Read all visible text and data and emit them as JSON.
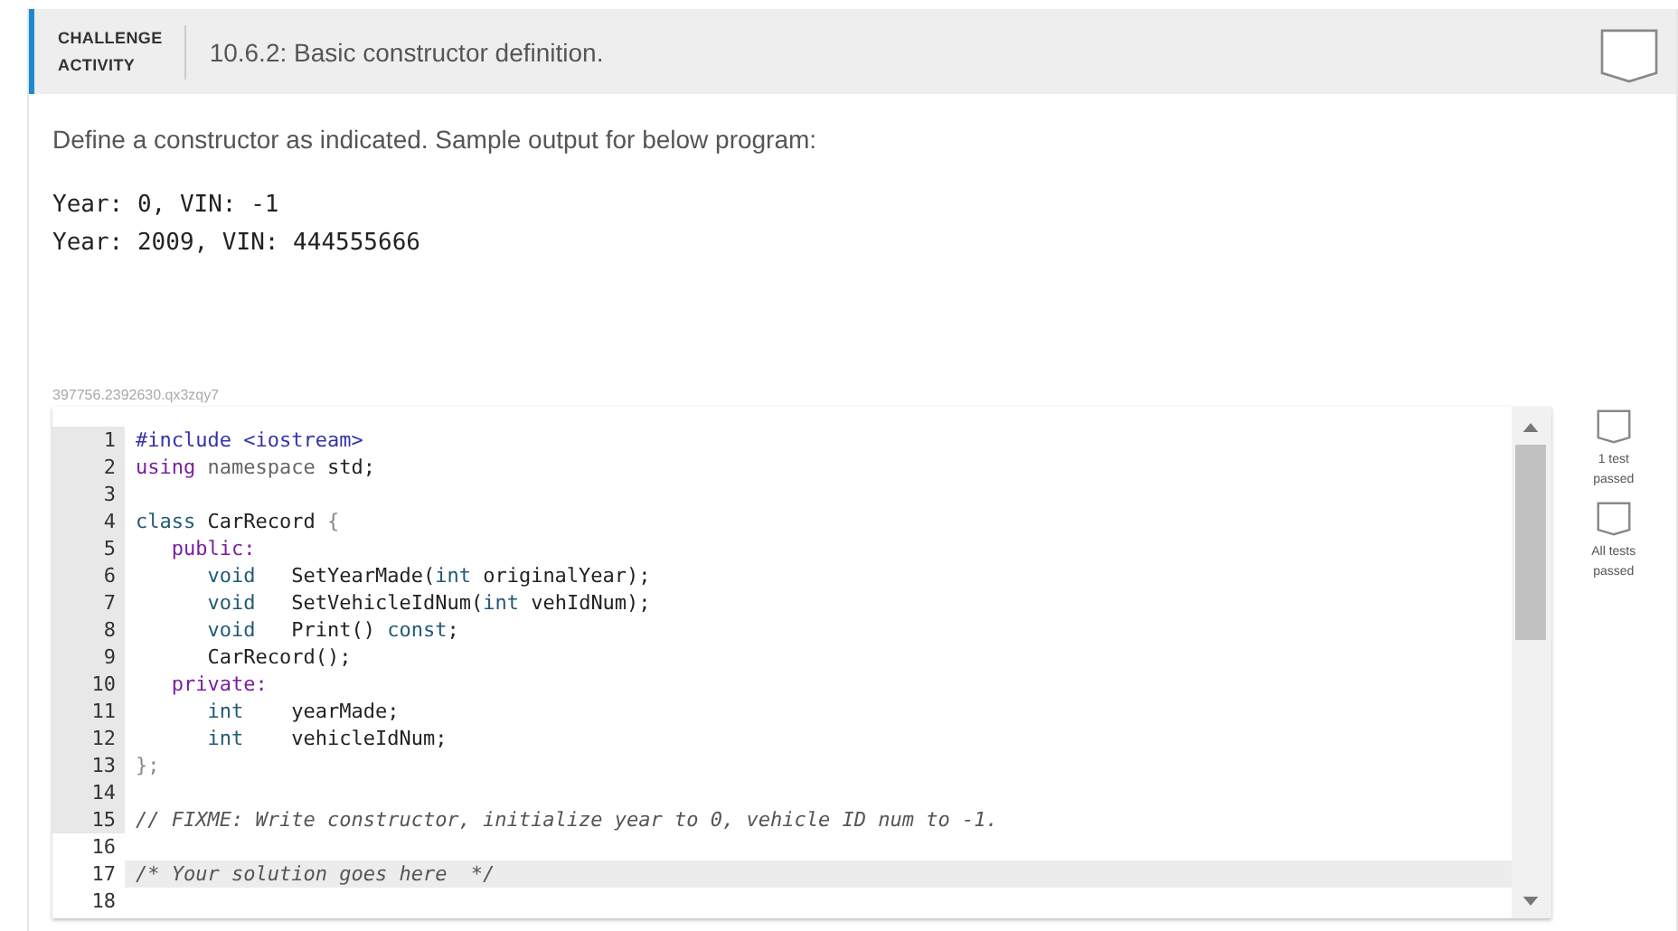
{
  "header": {
    "label_line1": "CHALLENGE",
    "label_line2": "ACTIVITY",
    "title": "10.6.2: Basic constructor definition.",
    "completed": false
  },
  "instructions": "Define a constructor as indicated. Sample output for below program:",
  "sample_output": [
    "Year: 0, VIN: -1",
    "Year: 2009, VIN: 444555666"
  ],
  "activity_id": "397756.2392630.qx3zqy7",
  "editor": {
    "lines": [
      {
        "number": "1",
        "read_only": true,
        "active": false,
        "tokens": [
          {
            "text": "#include <iostream>",
            "kind": "meta"
          }
        ]
      },
      {
        "number": "2",
        "read_only": true,
        "active": false,
        "tokens": [
          {
            "text": "using",
            "kind": "keyword"
          },
          {
            "text": " namespace",
            "kind": "muted"
          },
          {
            "text": " std;",
            "kind": "plain"
          }
        ]
      },
      {
        "number": "3",
        "read_only": true,
        "active": false
      },
      {
        "number": "4",
        "read_only": true,
        "active": false,
        "tokens": [
          {
            "text": "class",
            "kind": "type"
          },
          {
            "text": " CarRecord ",
            "kind": "plain"
          },
          {
            "text": "{",
            "kind": "punct"
          }
        ]
      },
      {
        "number": "5",
        "read_only": true,
        "active": false,
        "tokens": [
          {
            "text": "   public:",
            "kind": "keyword"
          }
        ]
      },
      {
        "number": "6",
        "read_only": true,
        "active": false,
        "tokens": [
          {
            "text": "      void",
            "kind": "type"
          },
          {
            "text": "   SetYearMade(",
            "kind": "plain"
          },
          {
            "text": "int",
            "kind": "type"
          },
          {
            "text": " originalYear);",
            "kind": "plain"
          }
        ]
      },
      {
        "number": "7",
        "read_only": true,
        "active": false,
        "tokens": [
          {
            "text": "      void",
            "kind": "type"
          },
          {
            "text": "   SetVehicleIdNum(",
            "kind": "plain"
          },
          {
            "text": "int",
            "kind": "type"
          },
          {
            "text": " vehIdNum);",
            "kind": "plain"
          }
        ]
      },
      {
        "number": "8",
        "read_only": true,
        "active": false,
        "tokens": [
          {
            "text": "      void",
            "kind": "type"
          },
          {
            "text": "   Print() ",
            "kind": "plain"
          },
          {
            "text": "const",
            "kind": "type"
          },
          {
            "text": ";",
            "kind": "plain"
          }
        ]
      },
      {
        "number": "9",
        "read_only": true,
        "active": false,
        "tokens": [
          {
            "text": "      CarRecord();",
            "kind": "plain"
          }
        ]
      },
      {
        "number": "10",
        "read_only": true,
        "active": false,
        "tokens": [
          {
            "text": "   private:",
            "kind": "keyword"
          }
        ]
      },
      {
        "number": "11",
        "read_only": true,
        "active": false,
        "tokens": [
          {
            "text": "      int",
            "kind": "type"
          },
          {
            "text": "    yearMade;",
            "kind": "plain"
          }
        ]
      },
      {
        "number": "12",
        "read_only": true,
        "active": false,
        "tokens": [
          {
            "text": "      int",
            "kind": "type"
          },
          {
            "text": "    vehicleIdNum;",
            "kind": "plain"
          }
        ]
      },
      {
        "number": "13",
        "read_only": true,
        "active": false,
        "tokens": [
          {
            "text": "};",
            "kind": "punct"
          }
        ]
      },
      {
        "number": "14",
        "read_only": true,
        "active": false
      },
      {
        "number": "15",
        "read_only": true,
        "active": false,
        "tokens": [
          {
            "text": "// FIXME: Write constructor, initialize year to 0, vehicle ID num to -1.",
            "kind": "comment"
          }
        ]
      },
      {
        "number": "16",
        "read_only": false,
        "active": false
      },
      {
        "number": "17",
        "read_only": false,
        "active": true,
        "tokens": [
          {
            "text": "/* Your solution goes here  */",
            "kind": "comment"
          }
        ]
      },
      {
        "number": "18",
        "read_only": false,
        "active": false
      }
    ]
  },
  "tests": [
    {
      "line1": "1 test",
      "line2": "passed",
      "passed": false
    },
    {
      "line1": "All tests",
      "line2": "passed",
      "passed": false
    }
  ]
}
